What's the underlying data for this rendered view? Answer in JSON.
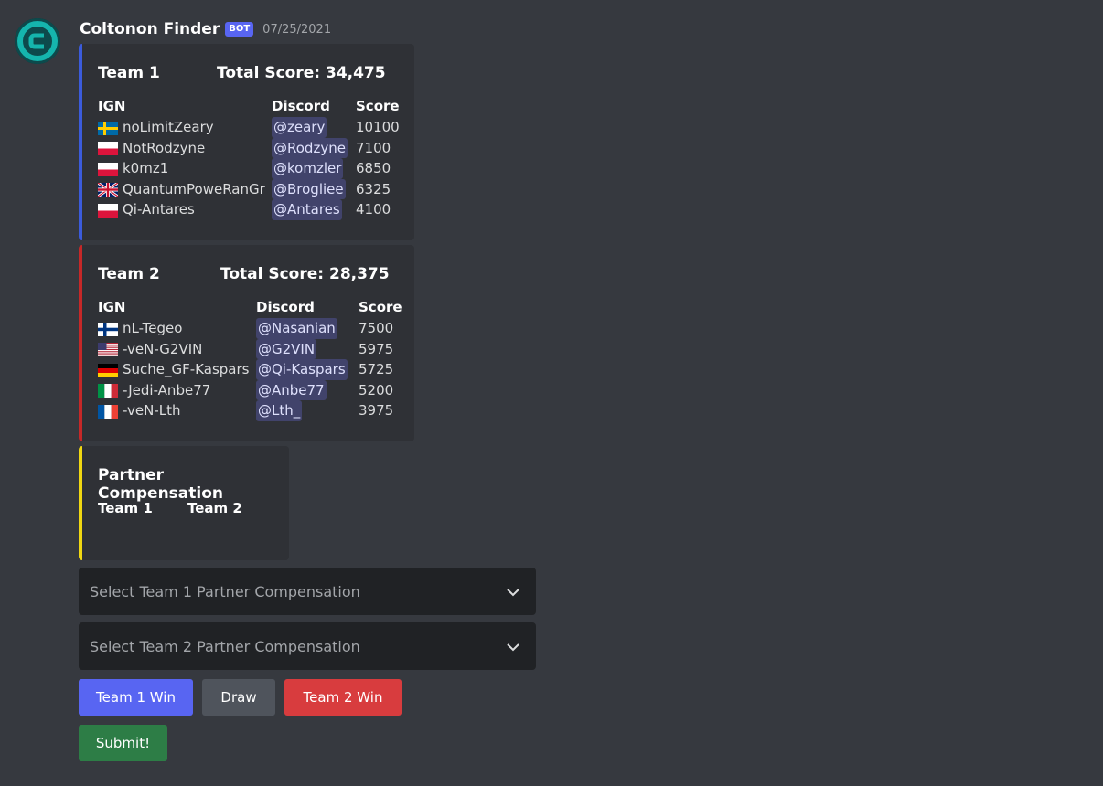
{
  "message": {
    "username": "Coltonon Finder",
    "bot_tag": "BOT",
    "timestamp": "07/25/2021"
  },
  "team1": {
    "title": "Team 1",
    "total": "Total Score: 34,475",
    "accent": "#3b5bdb",
    "headers": {
      "ign": "IGN",
      "discord": "Discord",
      "score": "Score"
    },
    "players": [
      {
        "flag": "se",
        "ign": "noLimitZeary",
        "discord": "@zeary",
        "score": "10100"
      },
      {
        "flag": "pl",
        "ign": "NotRodzyne",
        "discord": "@Rodzyne",
        "score": "7100"
      },
      {
        "flag": "pl",
        "ign": "k0mz1",
        "discord": "@komzler",
        "score": "6850"
      },
      {
        "flag": "gb",
        "ign": "QuantumPoweRanGr",
        "discord": "@Brogliee",
        "score": "6325"
      },
      {
        "flag": "pl",
        "ign": "Qi-Antares",
        "discord": "@Antares",
        "score": "4100"
      }
    ]
  },
  "team2": {
    "title": "Team 2",
    "total": "Total Score: 28,375",
    "accent": "#c62828",
    "headers": {
      "ign": "IGN",
      "discord": "Discord",
      "score": "Score"
    },
    "players": [
      {
        "flag": "fi",
        "ign": "nL-Tegeo",
        "discord": "@Nasanian",
        "score": "7500"
      },
      {
        "flag": "us",
        "ign": "-veN-G2VIN",
        "discord": "@G2VIN",
        "score": "5975"
      },
      {
        "flag": "de",
        "ign": "Suche_GF-Kaspars",
        "discord": "@Qi-Kaspars",
        "score": "5725"
      },
      {
        "flag": "it",
        "ign": "-Jedi-Anbe77",
        "discord": "@Anbe77",
        "score": "5200"
      },
      {
        "flag": "fr",
        "ign": "-veN-Lth",
        "discord": "@Lth_",
        "score": "3975"
      }
    ]
  },
  "partner": {
    "title": "Partner Compensation",
    "accent": "#f0d712",
    "team1": "Team 1",
    "team2": "Team 2"
  },
  "selects": {
    "team1_placeholder": "Select Team 1 Partner Compensation",
    "team2_placeholder": "Select Team 2 Partner Compensation"
  },
  "buttons": {
    "team1_win": "Team 1 Win",
    "draw": "Draw",
    "team2_win": "Team 2 Win",
    "submit": "Submit!"
  },
  "colors": {
    "blurple": "#5865f2",
    "grey": "#4f545c",
    "red": "#d83c3e",
    "green": "#2d7d46"
  }
}
